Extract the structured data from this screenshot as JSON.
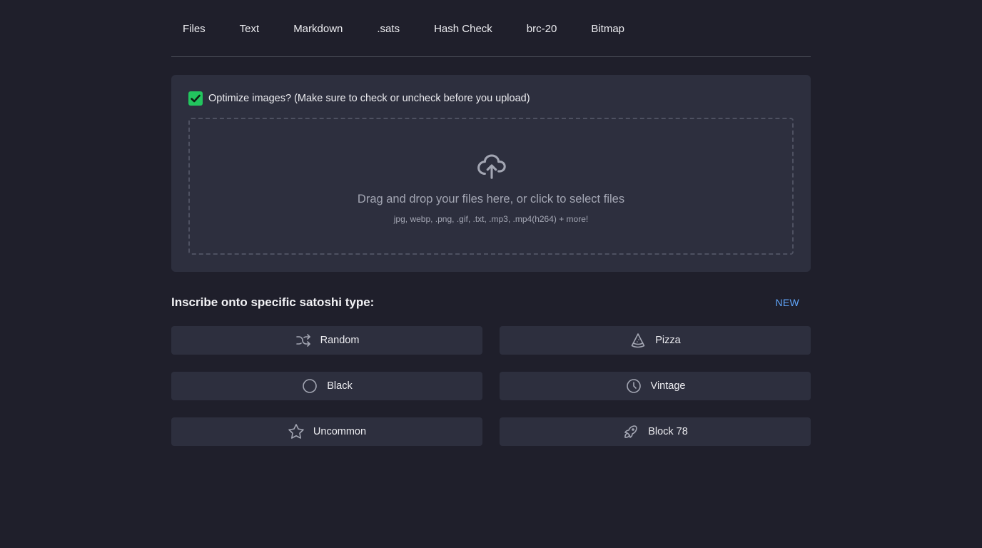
{
  "tabs": [
    {
      "label": "Files"
    },
    {
      "label": "Text"
    },
    {
      "label": "Markdown"
    },
    {
      "label": ".sats"
    },
    {
      "label": "Hash Check"
    },
    {
      "label": "brc-20"
    },
    {
      "label": "Bitmap"
    }
  ],
  "upload": {
    "optimize_label": "Optimize images? (Make sure to check or uncheck before you upload)",
    "optimize_checked": true,
    "dropzone_main": "Drag and drop your files here, or click to select files",
    "dropzone_sub": "jpg, webp, .png, .gif, .txt, .mp3, .mp4(h264) + more!",
    "icon": "cloud-upload-icon"
  },
  "satoshi": {
    "title": "Inscribe onto specific satoshi type:",
    "badge": "NEW",
    "options": [
      {
        "label": "Random",
        "icon": "shuffle-icon"
      },
      {
        "label": "Pizza",
        "icon": "pizza-icon"
      },
      {
        "label": "Black",
        "icon": "circle-icon"
      },
      {
        "label": "Vintage",
        "icon": "clock-icon"
      },
      {
        "label": "Uncommon",
        "icon": "star-icon"
      },
      {
        "label": "Block 78",
        "icon": "rocket-icon"
      }
    ]
  },
  "colors": {
    "background": "#1f1f2b",
    "panel": "#2d2f3e",
    "checkbox": "#22c55e",
    "accent": "#60a5fa"
  }
}
